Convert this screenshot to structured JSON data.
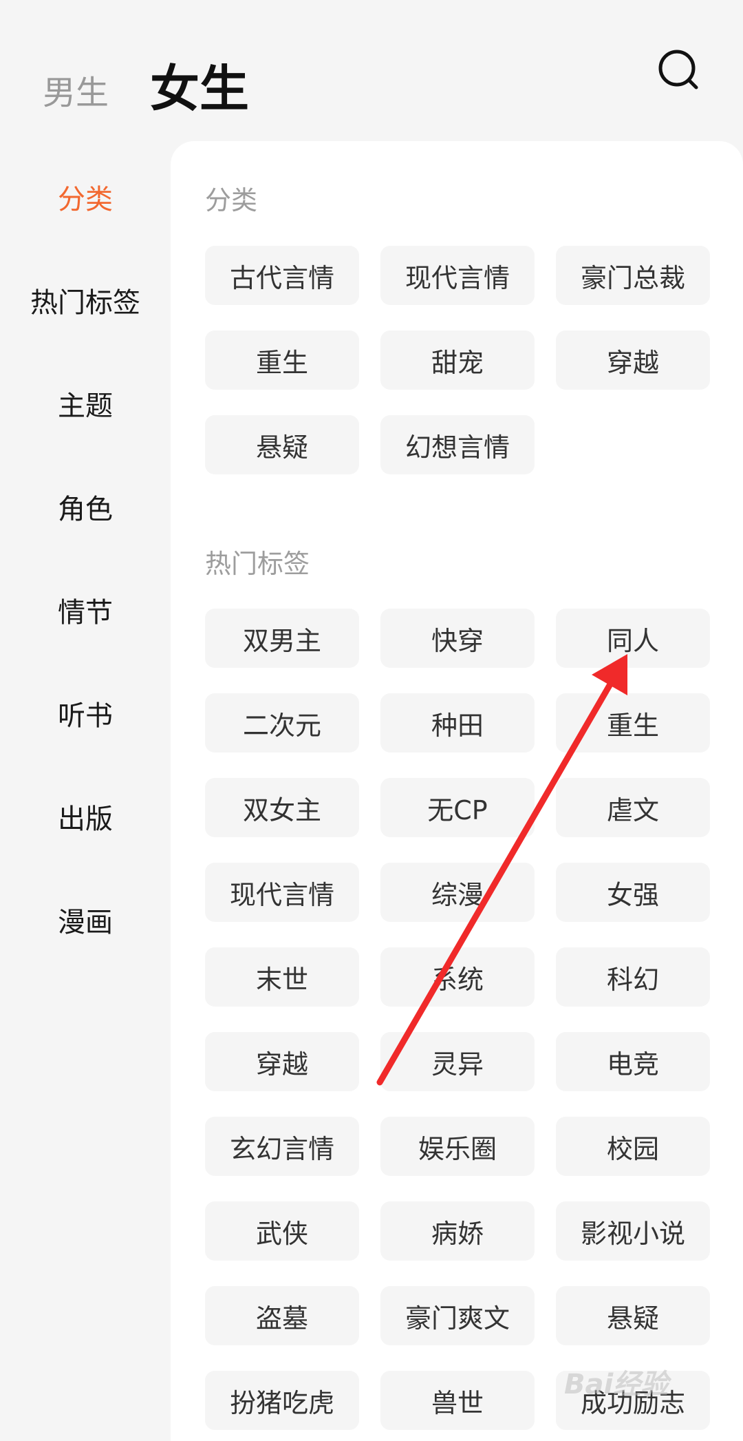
{
  "header": {
    "tab_male": "男生",
    "tab_female": "女生",
    "search_icon": "search-icon"
  },
  "sidebar": {
    "items": [
      {
        "label": "分类",
        "active": true
      },
      {
        "label": "热门标签",
        "active": false
      },
      {
        "label": "主题",
        "active": false
      },
      {
        "label": "角色",
        "active": false
      },
      {
        "label": "情节",
        "active": false
      },
      {
        "label": "听书",
        "active": false
      },
      {
        "label": "出版",
        "active": false
      },
      {
        "label": "漫画",
        "active": false
      }
    ]
  },
  "sections": [
    {
      "title": "分类",
      "tags": [
        "古代言情",
        "现代言情",
        "豪门总裁",
        "重生",
        "甜宠",
        "穿越",
        "悬疑",
        "幻想言情"
      ]
    },
    {
      "title": "热门标签",
      "tags": [
        "双男主",
        "快穿",
        "同人",
        "二次元",
        "种田",
        "重生",
        "双女主",
        "无CP",
        "虐文",
        "现代言情",
        "综漫",
        "女强",
        "末世",
        "系统",
        "科幻",
        "穿越",
        "灵异",
        "电竞",
        "玄幻言情",
        "娱乐圈",
        "校园",
        "武侠",
        "病娇",
        "影视小说",
        "盗墓",
        "豪门爽文",
        "悬疑",
        "扮猪吃虎",
        "兽世",
        "成功励志"
      ]
    }
  ],
  "colors": {
    "accent": "#f2682f",
    "annotation_arrow": "#f02a2a"
  },
  "watermark": "Bai经验"
}
